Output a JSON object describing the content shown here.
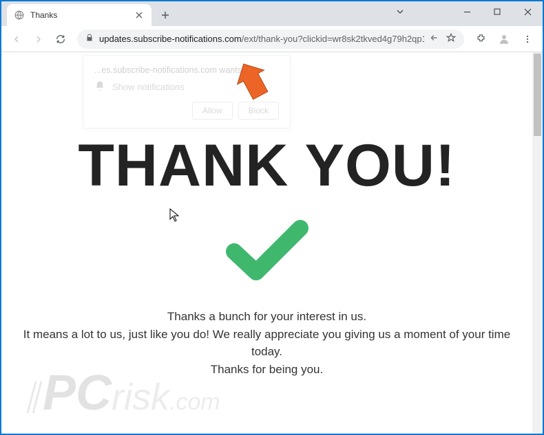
{
  "window": {
    "tab_title": "Thanks"
  },
  "address": {
    "domain": "updates.subscribe-notifications.com",
    "path": "/ext/thank-you?clickid=wr8sk2tkved4g79h2qp1..."
  },
  "notification": {
    "origin": "...es.subscribe-notifications.com wants to",
    "prompt": "Show notifications",
    "allow": "Allow",
    "block": "Block"
  },
  "page": {
    "heading": "THANK YOU!",
    "line1": "Thanks a bunch for your interest in us.",
    "line2": "It means a lot to us, just like you do! We really appreciate you giving us a moment of your time today.",
    "line3": "Thanks for being you."
  },
  "watermark": {
    "part1": "PC",
    "part2": "risk",
    "part3": ".com"
  },
  "colors": {
    "checkmark": "#3fb86e",
    "arrow": "#ec6526",
    "border": "#0078d4"
  }
}
